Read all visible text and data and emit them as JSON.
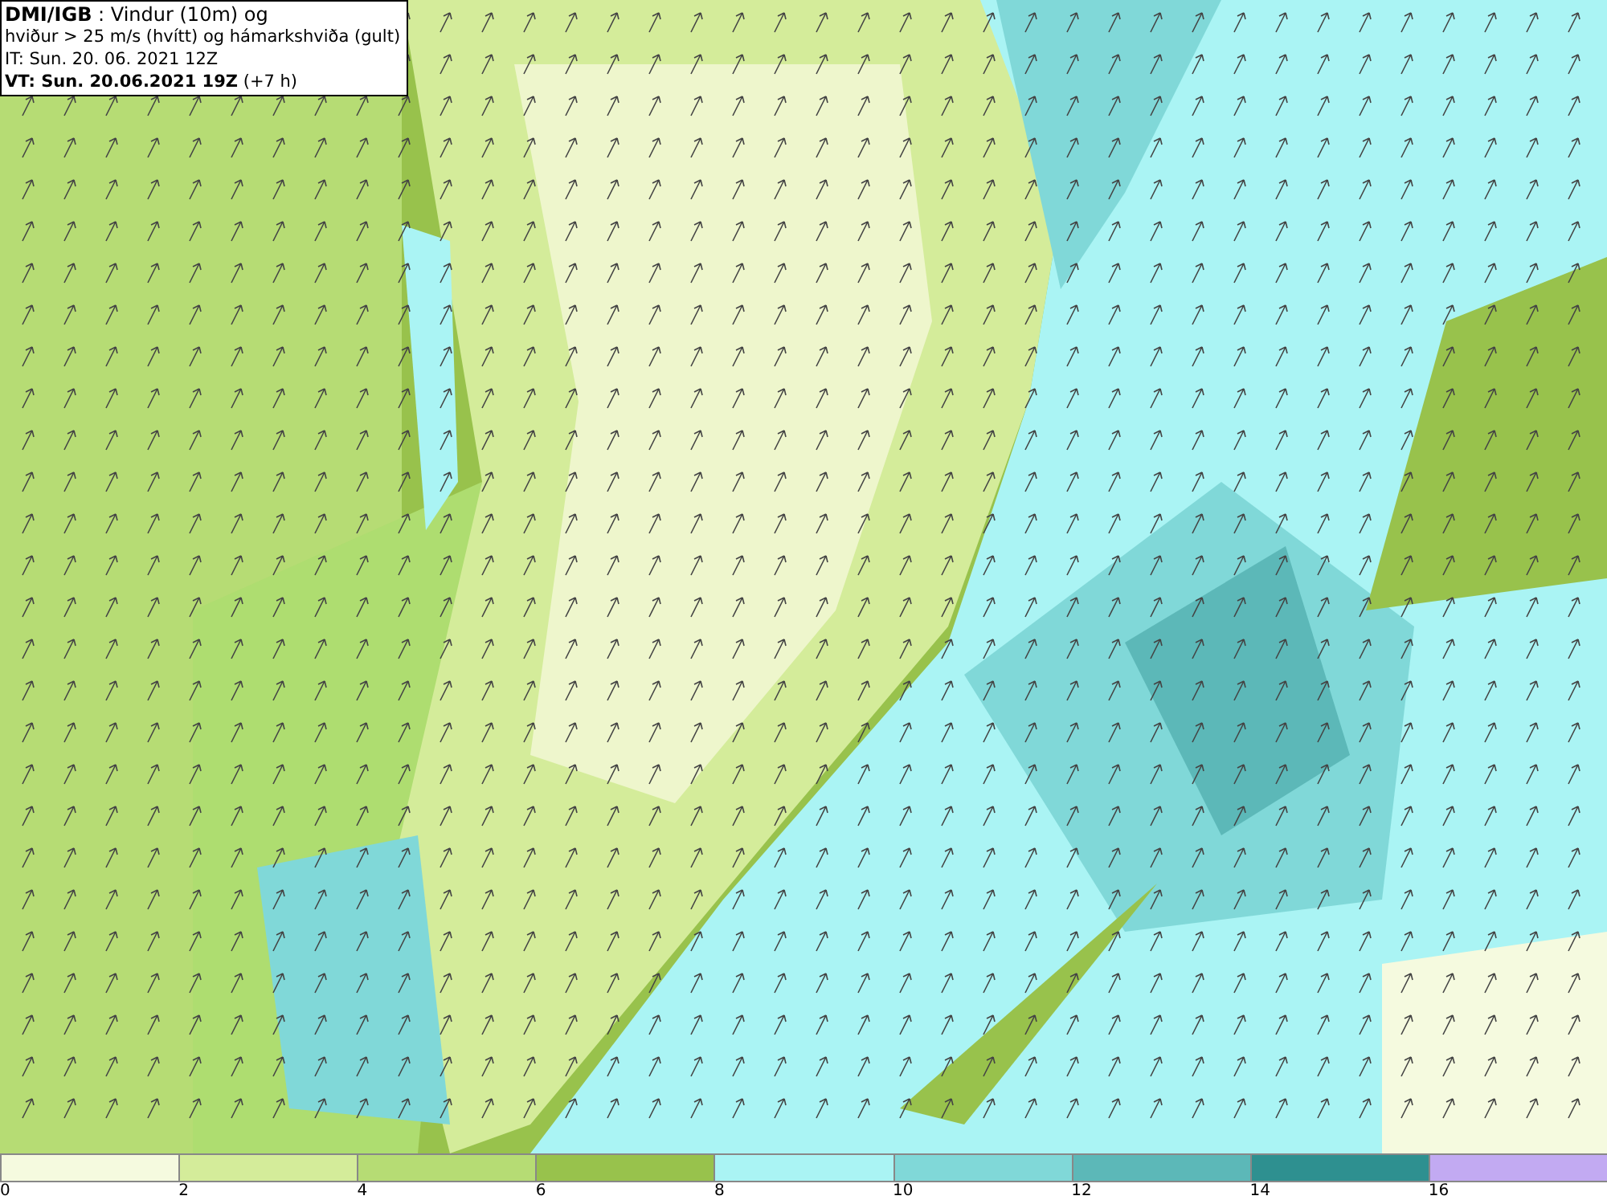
{
  "title_box": {
    "lines": [
      "**DMI/IGB** : Vindur (10m) og",
      "hviður > 25 m/s (hvítt) og hámarkshviða (gult)",
      "IT: Sun. 20. 06. 2021 12Z",
      "**VT: Sun. 20.06.2021 19Z** (+7 h)"
    ]
  },
  "legend": {
    "segments": [
      {
        "label": "0",
        "color": "#f5fadf"
      },
      {
        "label": "2",
        "color": "#d4ec9a"
      },
      {
        "label": "4",
        "color": "#b6dc74"
      },
      {
        "label": "6",
        "color": "#98c24c"
      },
      {
        "label": "8",
        "color": "#aaf4f4"
      },
      {
        "label": "10",
        "color": "#80d8d8"
      },
      {
        "label": "12",
        "color": "#5cb8b8"
      },
      {
        "label": "14",
        "color": "#2e9090"
      },
      {
        "label": "16",
        "color": "#c2aaf2"
      }
    ]
  }
}
